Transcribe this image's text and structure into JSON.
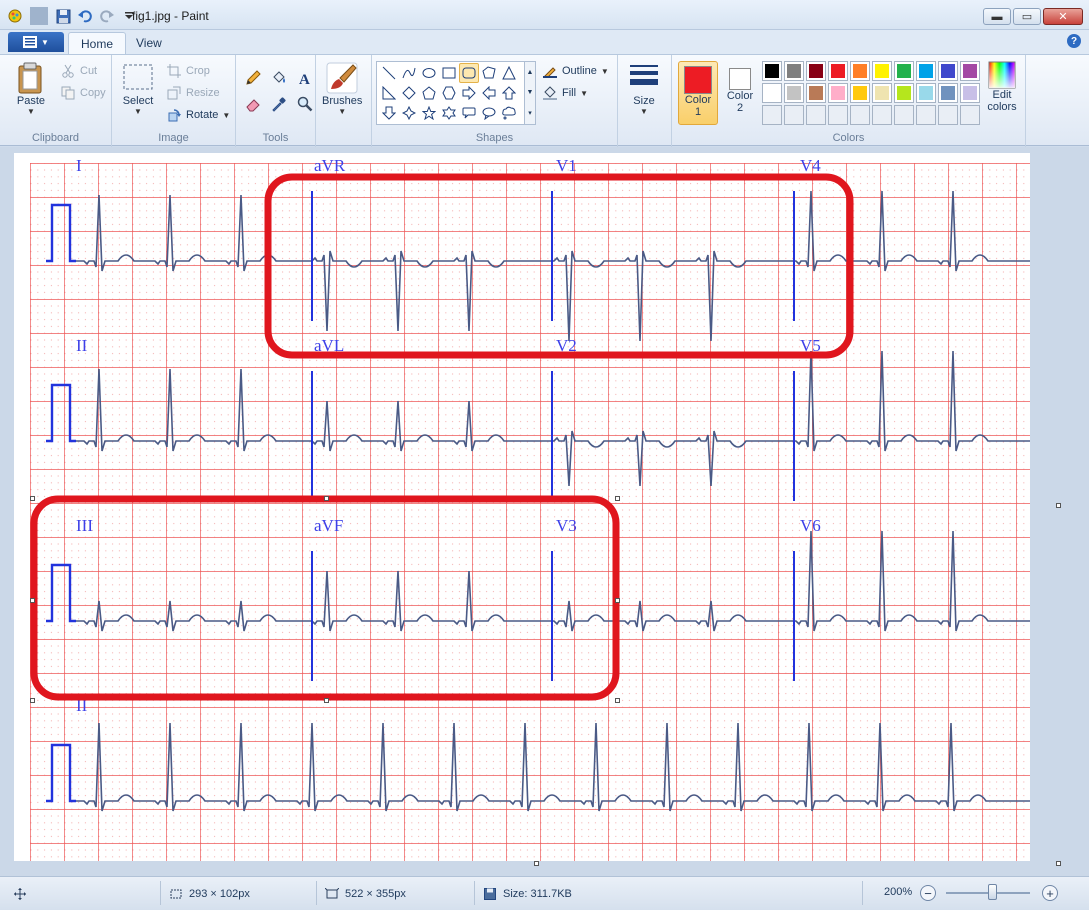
{
  "window": {
    "title": "fig1.jpg - Paint",
    "controls": {
      "minimize": "▬",
      "maximize": "▭",
      "close": "✕"
    }
  },
  "tabs": [
    {
      "label": "Home",
      "active": true
    },
    {
      "label": "View",
      "active": false
    }
  ],
  "ribbon": {
    "clipboard": {
      "label": "Clipboard",
      "paste": "Paste",
      "cut": "Cut",
      "copy": "Copy"
    },
    "image": {
      "label": "Image",
      "select": "Select",
      "crop": "Crop",
      "resize": "Resize",
      "rotate": "Rotate"
    },
    "tools": {
      "label": "Tools"
    },
    "brushes": {
      "label": "Brushes"
    },
    "shapes": {
      "label": "Shapes",
      "outline": "Outline",
      "fill": "Fill"
    },
    "size": {
      "label": "Size"
    },
    "colors": {
      "label": "Colors",
      "color1_label": "Color",
      "color1_num": "1",
      "color2_label": "Color",
      "color2_num": "2",
      "edit_label": "Edit",
      "edit_label2": "colors",
      "color1": "#ed1c24",
      "color2": "#ffffff",
      "palette": [
        "#000000",
        "#7f7f7f",
        "#880015",
        "#ed1c24",
        "#ff7f27",
        "#fff200",
        "#22b14c",
        "#00a2e8",
        "#3f48cc",
        "#a349a4",
        "#ffffff",
        "#c3c3c3",
        "#b97a57",
        "#ffaec9",
        "#ffc90e",
        "#efe4b0",
        "#b5e61d",
        "#99d9ea",
        "#7092be",
        "#c8bfe7"
      ]
    }
  },
  "ecg": {
    "leads_row1": [
      "I",
      "aVR",
      "V1",
      "V4"
    ],
    "leads_row2": [
      "II",
      "aVL",
      "V2",
      "V5"
    ],
    "leads_row3": [
      "III",
      "aVF",
      "V3",
      "V6"
    ],
    "leads_row4": [
      "II"
    ]
  },
  "status": {
    "selection_size": "293 × 102px",
    "image_size": "522 × 355px",
    "file_size": "Size: 311.7KB",
    "zoom": "200%"
  }
}
